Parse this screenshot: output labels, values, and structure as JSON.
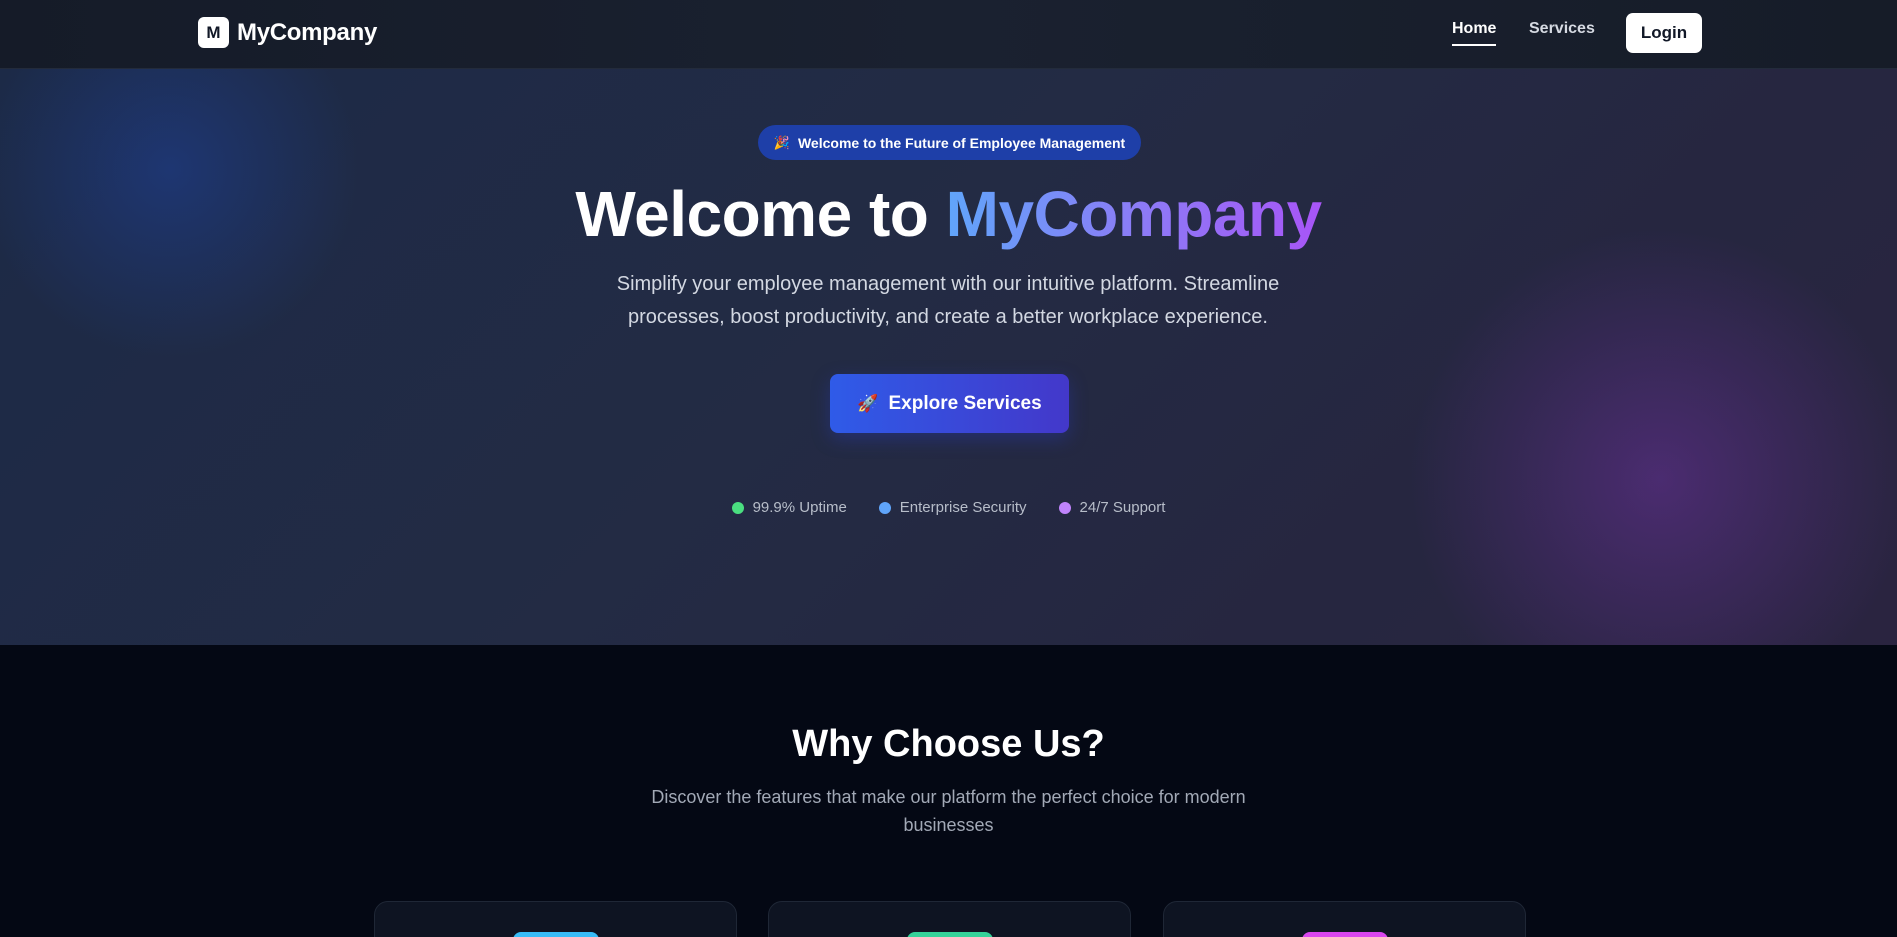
{
  "nav": {
    "logo_letter": "M",
    "brand": "MyCompany",
    "links": [
      {
        "label": "Home",
        "active": true
      },
      {
        "label": "Services",
        "active": false
      }
    ],
    "login_label": "Login"
  },
  "hero": {
    "badge_emoji": "🎉",
    "badge_text": "Welcome to the Future of Employee Management",
    "title_prefix": "Welcome to ",
    "title_accent": "MyCompany",
    "subtitle": "Simplify your employee management with our intuitive platform. Streamline processes, boost productivity, and create a better workplace experience.",
    "cta_emoji": "🚀",
    "cta_label": "Explore Services",
    "features": [
      {
        "label": "99.9% Uptime",
        "color": "#4ade80"
      },
      {
        "label": "Enterprise Security",
        "color": "#60a5fa"
      },
      {
        "label": "24/7 Support",
        "color": "#c084fc"
      }
    ]
  },
  "why": {
    "title": "Why Choose Us?",
    "subtitle": "Discover the features that make our platform the perfect choice for modern businesses",
    "cards": [
      {
        "icon_color": "#38bdf8"
      },
      {
        "icon_color": "#34d399"
      },
      {
        "icon_color": "#d946ef"
      }
    ]
  },
  "colors": {
    "accent_blue": "#2f5be8",
    "accent_purple": "#a855f7",
    "background": "#040814"
  }
}
